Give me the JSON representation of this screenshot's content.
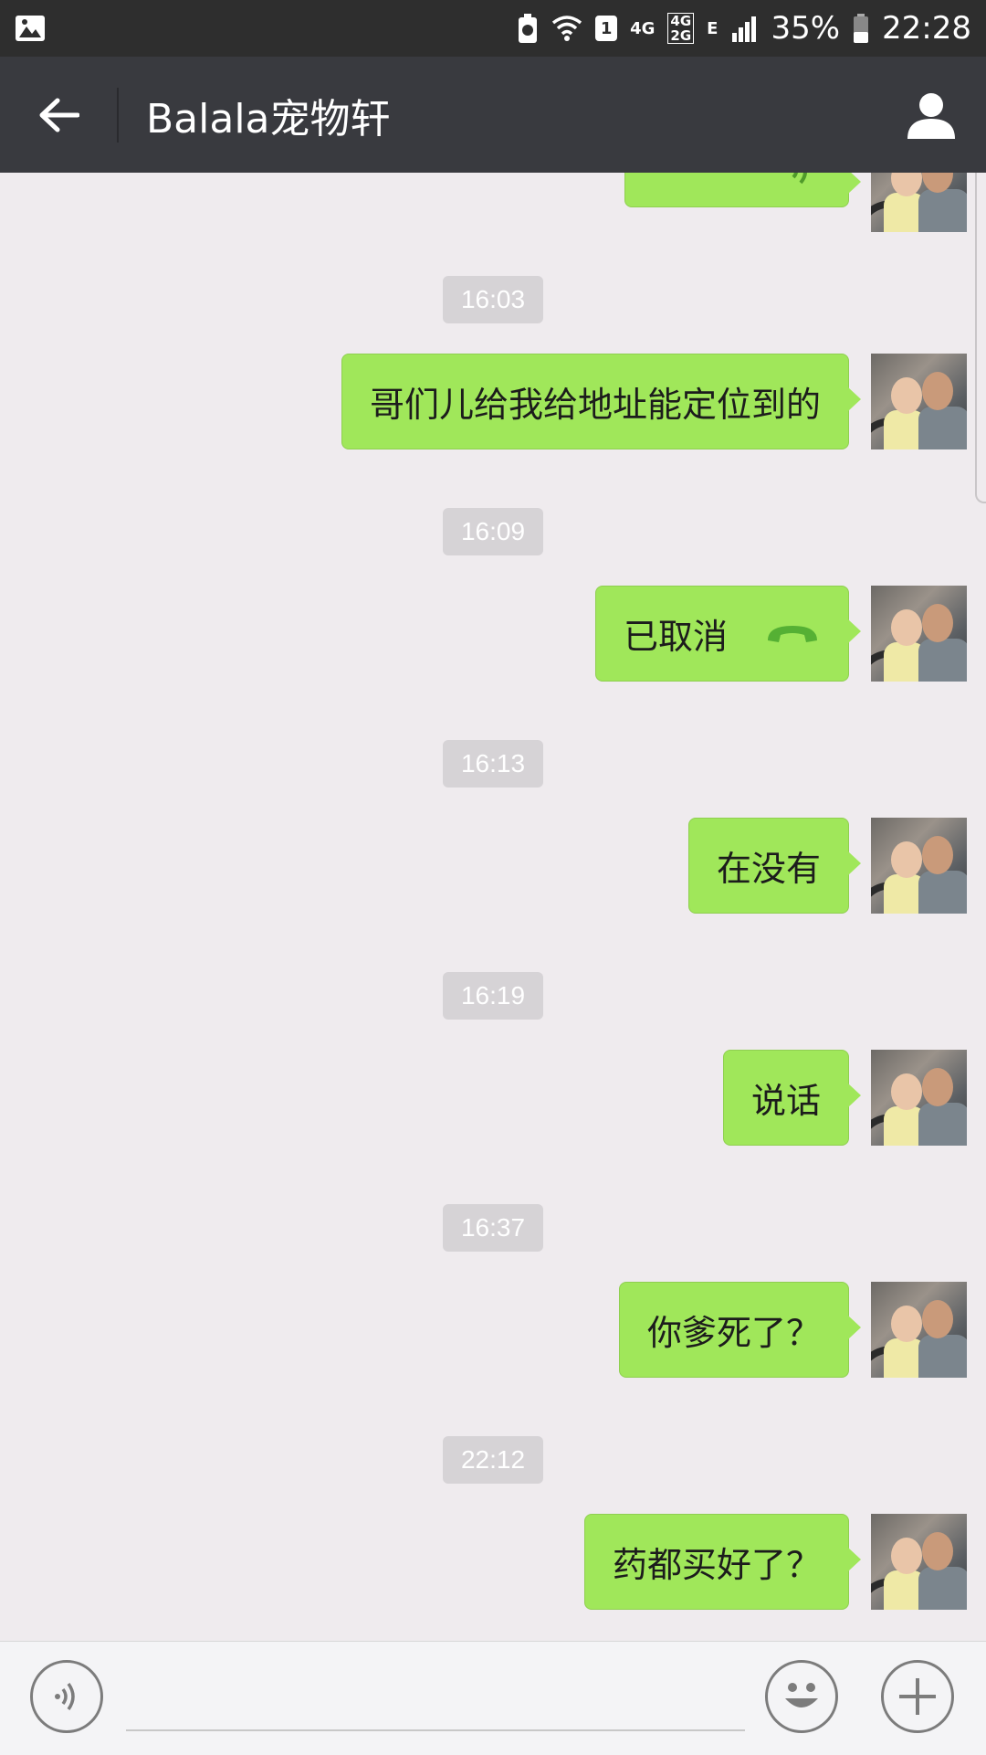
{
  "status_bar": {
    "network_small": "4G",
    "network_box_top": "4G",
    "network_box_bottom": "2G",
    "network_e": "E",
    "sim": "1",
    "battery": "35%",
    "time": "22:28"
  },
  "header": {
    "title": "Balala宠物轩"
  },
  "messages": [
    {
      "timestamp": "16:03",
      "text": "哥们儿给我给地址能定位到的"
    },
    {
      "timestamp": "16:09",
      "text": "已取消",
      "type": "call"
    },
    {
      "timestamp": "16:13",
      "text": "在没有"
    },
    {
      "timestamp": "16:19",
      "text": "说话"
    },
    {
      "timestamp": "16:37",
      "text": "你爹死了？"
    },
    {
      "timestamp": "22:12",
      "text": "药都买好了？"
    }
  ],
  "input_bar": {
    "placeholder": ""
  },
  "colors": {
    "bubble": "#a0e75a",
    "header": "#393a3f",
    "background": "#efebee"
  }
}
